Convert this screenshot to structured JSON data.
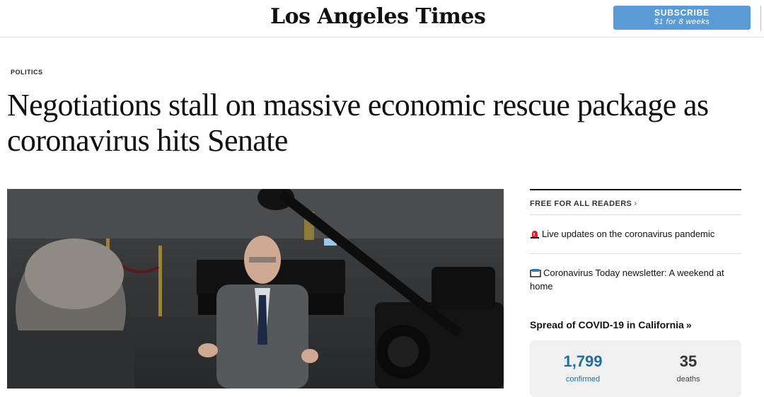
{
  "header": {
    "logo_text": "Los Angeles Times",
    "subscribe_label": "SUBSCRIBE",
    "subscribe_offer": "$1 for 8 weeks"
  },
  "article": {
    "section": "POLITICS",
    "headline": "Negotiations stall on massive economic rescue package as coronavirus hits Senate",
    "photo_alt": "Photo of a man in a suit speaking to reporters and cameras"
  },
  "sidebar": {
    "free_label": "FREE FOR ALL READERS",
    "links": [
      {
        "icon": "siren-icon",
        "text": "Live updates on the coronavirus pandemic"
      },
      {
        "icon": "newsletter-icon",
        "text": "Coronavirus Today newsletter: A weekend at home"
      }
    ],
    "spread_title": "Spread of COVID-19 in California",
    "spread_arrow": "»",
    "stats": [
      {
        "value": "1,799",
        "label": "confirmed",
        "color": "#1f6f9e"
      },
      {
        "value": "35",
        "label": "deaths",
        "color": "#333333"
      }
    ]
  },
  "colors": {
    "subscribe_bg": "#5b9bd5",
    "confirmed": "#1f6f9e"
  }
}
